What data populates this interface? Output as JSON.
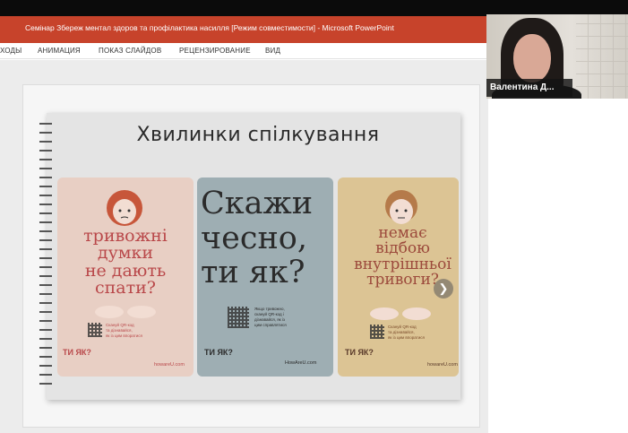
{
  "window": {
    "title": "Семінар Збереж ментал здоров та профілактика насилля [Режим совместимости] - Microsoft PowerPoint",
    "accent_color": "#c7432b"
  },
  "ribbon": {
    "tabs": [
      "ХОДЫ",
      "АНИМАЦИЯ",
      "ПОКАЗ СЛАЙДОВ",
      "РЕЦЕНЗИРОВАНИЕ",
      "ВИД"
    ]
  },
  "slide": {
    "title": "Хвилинки спілкування",
    "cards": [
      {
        "headline": "тривожні\nдумки\nне дають\nспати?",
        "small_text": "Скануй QR-код\nта дізнавайся,\nяк із цим впоратися",
        "logo": "ТИ ЯК?",
        "url": "howareU.com",
        "color": "#e8cfc4"
      },
      {
        "headline": "Скажи\nчесно,\nти як?",
        "small_text": "Якщо тривожно,\nскануй QR-код і\nдізнавайся, як із\nцим справлятися",
        "logo": "ТИ ЯК?",
        "url": "HowAreU.com",
        "color": "#9eaeb3"
      },
      {
        "headline": "немає\nвідбою\nвнутрішньої\nтривоги?",
        "small_text": "Скануй QR-код\nта дізнавайся,\nяк із цим впоратися",
        "logo": "ТИ ЯК?",
        "url": "howareU.com",
        "color": "#dcc494"
      }
    ],
    "next_icon": "chevron-right-icon"
  },
  "webcam": {
    "participant_name": "Валентина Д..."
  }
}
